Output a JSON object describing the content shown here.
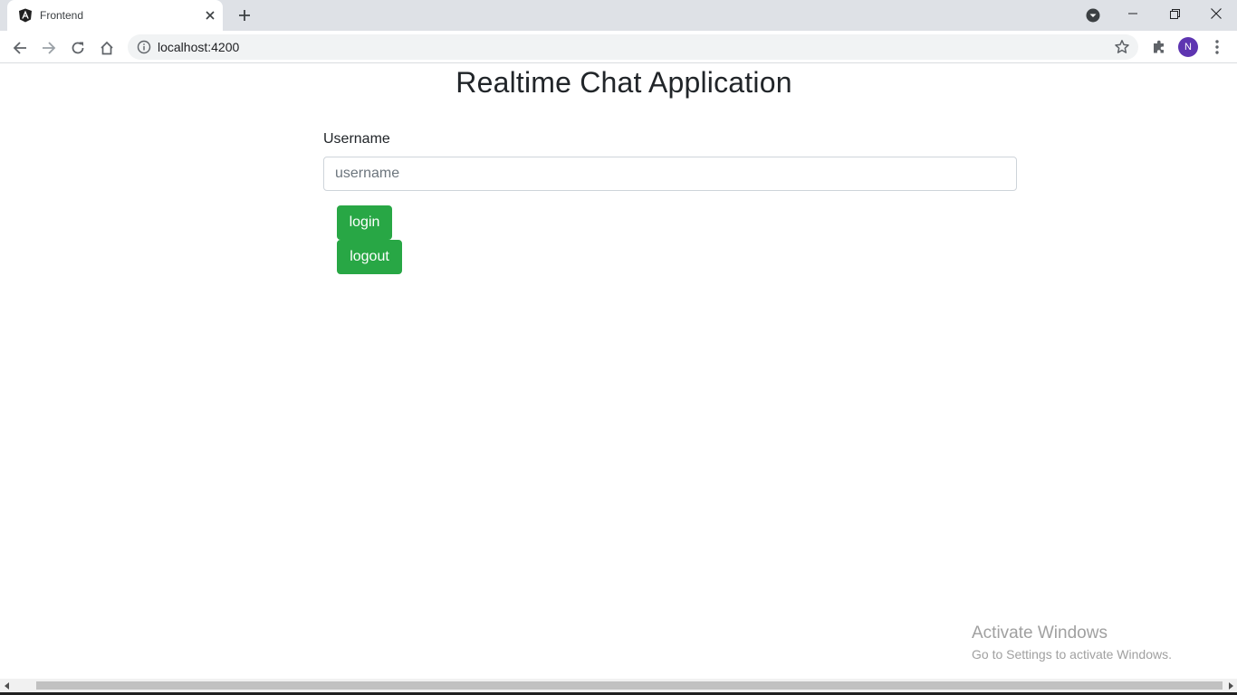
{
  "browser": {
    "tab": {
      "title": "Frontend",
      "favicon": "angular-icon"
    },
    "address_bar": {
      "url": "localhost:4200"
    },
    "profile_initial": "N",
    "colors": {
      "tab_strip": "#dee1e6",
      "avatar": "#5e35b1"
    }
  },
  "page": {
    "title": "Realtime Chat Application",
    "form": {
      "username_label": "Username",
      "username_placeholder": "username",
      "username_value": ""
    },
    "buttons": {
      "login_label": "login",
      "logout_label": "logout"
    },
    "colors": {
      "button_success": "#28a745"
    }
  },
  "os_overlay": {
    "title": "Activate Windows",
    "subtitle": "Go to Settings to activate Windows."
  }
}
